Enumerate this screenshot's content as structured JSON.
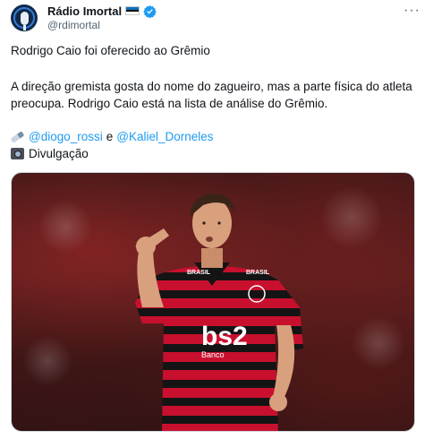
{
  "author": {
    "display_name": "Rádio Imortal",
    "handle": "@rdimortal",
    "flag_colors": [
      "#0d6fb8",
      "#111111",
      "#ffffff"
    ],
    "verified_color": "#1d9bf0",
    "avatar_icon": "microphone-icon"
  },
  "more_label": "···",
  "post": {
    "line1": "Rodrigo Caio foi oferecido ao Grêmio",
    "para2": "A direção gremista gosta do nome do zagueiro, mas a parte física do atleta preocupa. Rodrigo Caio está na lista de análise do Grêmio.",
    "credit_mention_1": "@diogo_rossi",
    "credit_joiner": "e",
    "credit_mention_2": "@Kaliel_Dorneles",
    "photo_credit": "Divulgação"
  },
  "photo": {
    "jersey_text": "bs2",
    "jersey_subtext": "Banco",
    "sleeve_text": "BRASIL",
    "colors": {
      "stripe_red": "#c8102e",
      "stripe_black": "#141414",
      "skin": "#d9a07e",
      "hair": "#3a2418"
    }
  }
}
